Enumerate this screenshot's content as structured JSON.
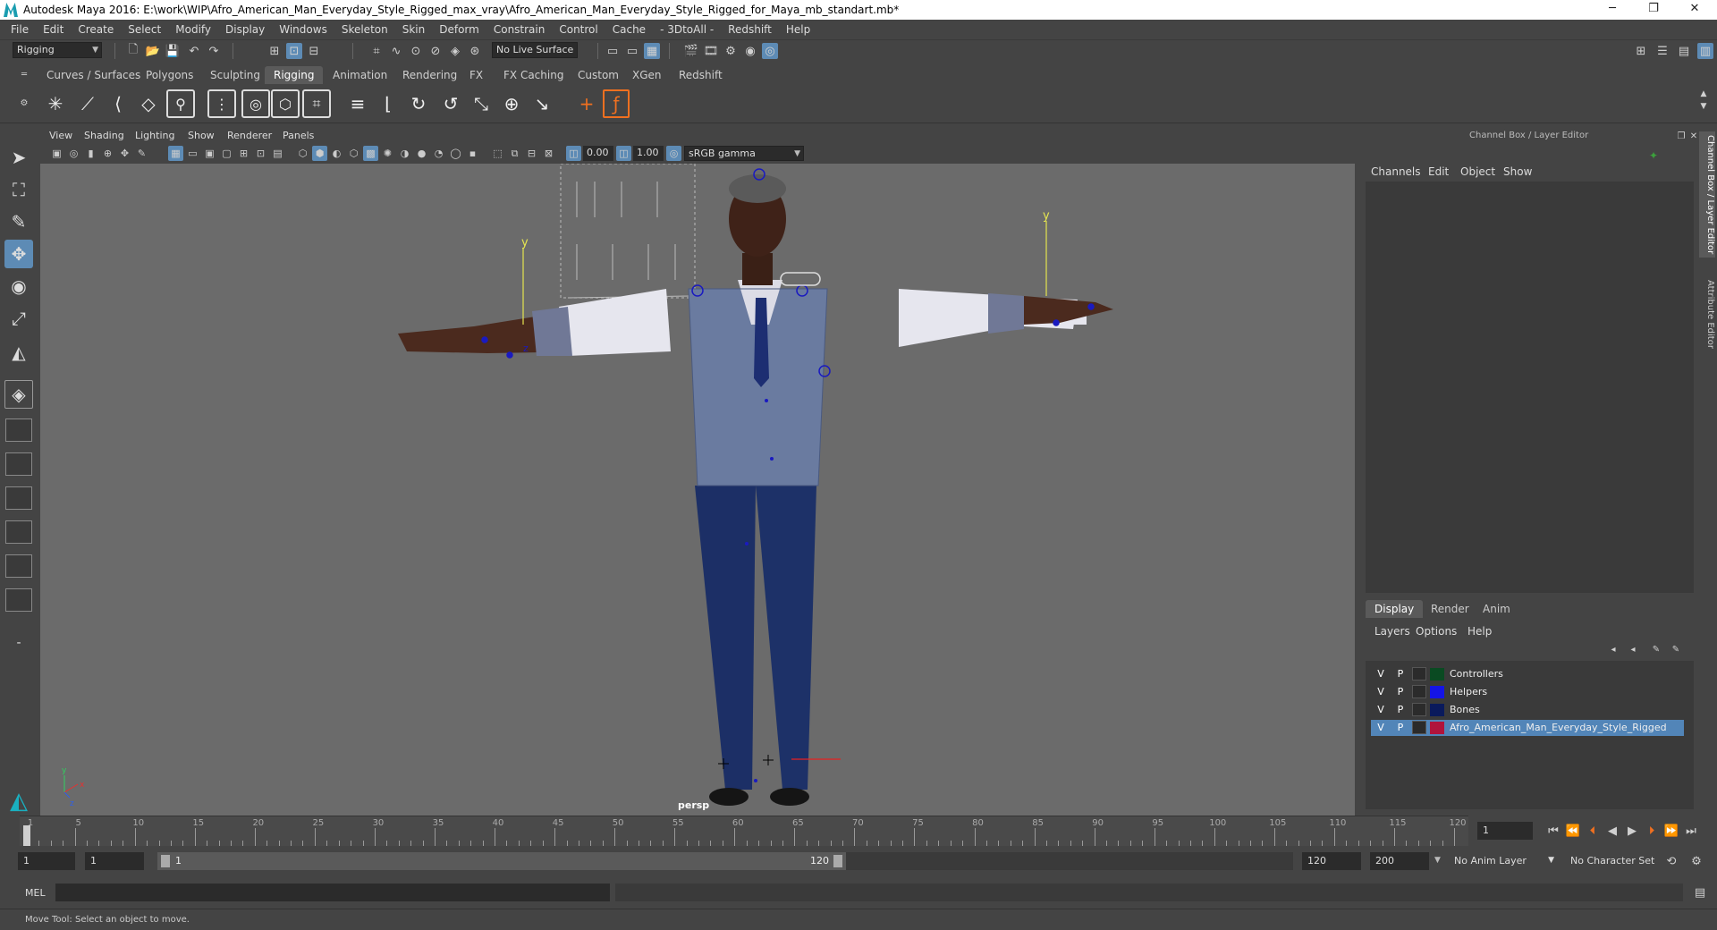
{
  "window": {
    "title": "Autodesk Maya 2016: E:\\work\\WIP\\Afro_American_Man_Everyday_Style_Rigged_max_vray\\Afro_American_Man_Everyday_Style_Rigged_for_Maya_mb_standart.mb*",
    "minimize": "─",
    "restore": "❐",
    "close": "✕"
  },
  "menubar": [
    "File",
    "Edit",
    "Create",
    "Select",
    "Modify",
    "Display",
    "Windows",
    "Skeleton",
    "Skin",
    "Deform",
    "Constrain",
    "Control",
    "Cache",
    "- 3DtoAll -",
    "Redshift",
    "Help"
  ],
  "statusline": {
    "menuset": "Rigging",
    "live_surface": "No Live Surface"
  },
  "shelf": {
    "tabs": [
      "Curves / Surfaces",
      "Polygons",
      "Sculpting",
      "Rigging",
      "Animation",
      "Rendering",
      "FX",
      "FX Caching",
      "Custom",
      "XGen",
      "Redshift"
    ],
    "active_tab": "Rigging"
  },
  "viewport": {
    "menu": [
      "View",
      "Shading",
      "Lighting",
      "Show",
      "Renderer",
      "Panels"
    ],
    "exposure": "0.00",
    "gamma": "1.00",
    "color_space": "sRGB gamma",
    "camera": "persp",
    "axis_y": "y",
    "axis_z": "z",
    "axis_x": "x",
    "axis_y2": "y",
    "axis_z2": "z"
  },
  "channelbox": {
    "title": "Channel Box / Layer Editor",
    "menu": [
      "Channels",
      "Edit",
      "Object",
      "Show"
    ]
  },
  "layereditor": {
    "tabs": [
      "Display",
      "Render",
      "Anim"
    ],
    "active_tab": "Display",
    "menu": [
      "Layers",
      "Options",
      "Help"
    ],
    "layers": [
      {
        "v": "V",
        "p": "P",
        "name": "Controllers",
        "color": "#0a4a22",
        "selected": false
      },
      {
        "v": "V",
        "p": "P",
        "name": "Helpers",
        "color": "#1414e6",
        "selected": false
      },
      {
        "v": "V",
        "p": "P",
        "name": "Bones",
        "color": "#0a1a5c",
        "selected": false
      },
      {
        "v": "V",
        "p": "P",
        "name": "Afro_American_Man_Everyday_Style_Rigged",
        "color": "#b0143c",
        "selected": true
      }
    ]
  },
  "sidetabs": [
    "Channel Box / Layer Editor",
    "Attribute Editor"
  ],
  "timeslider": {
    "labels": [
      "1",
      "5",
      "10",
      "15",
      "20",
      "25",
      "30",
      "35",
      "40",
      "45",
      "50",
      "55",
      "60",
      "65",
      "70",
      "75",
      "80",
      "85",
      "90",
      "95",
      "100",
      "105",
      "110",
      "115",
      "120"
    ],
    "current_frame": "1"
  },
  "range": {
    "start": "1",
    "playback_start": "1",
    "slider_start": "1",
    "slider_end": "120",
    "playback_end": "120",
    "end": "200",
    "anim_layer": "No Anim Layer",
    "character_set": "No Character Set"
  },
  "cmdline": {
    "mode": "MEL"
  },
  "helpline": {
    "text": "Move Tool: Select an object to move."
  },
  "colors": {
    "viewport_bg": "#6b6b6b",
    "highlight": "#5d8bb5",
    "selected_layer": "#5285b8"
  }
}
